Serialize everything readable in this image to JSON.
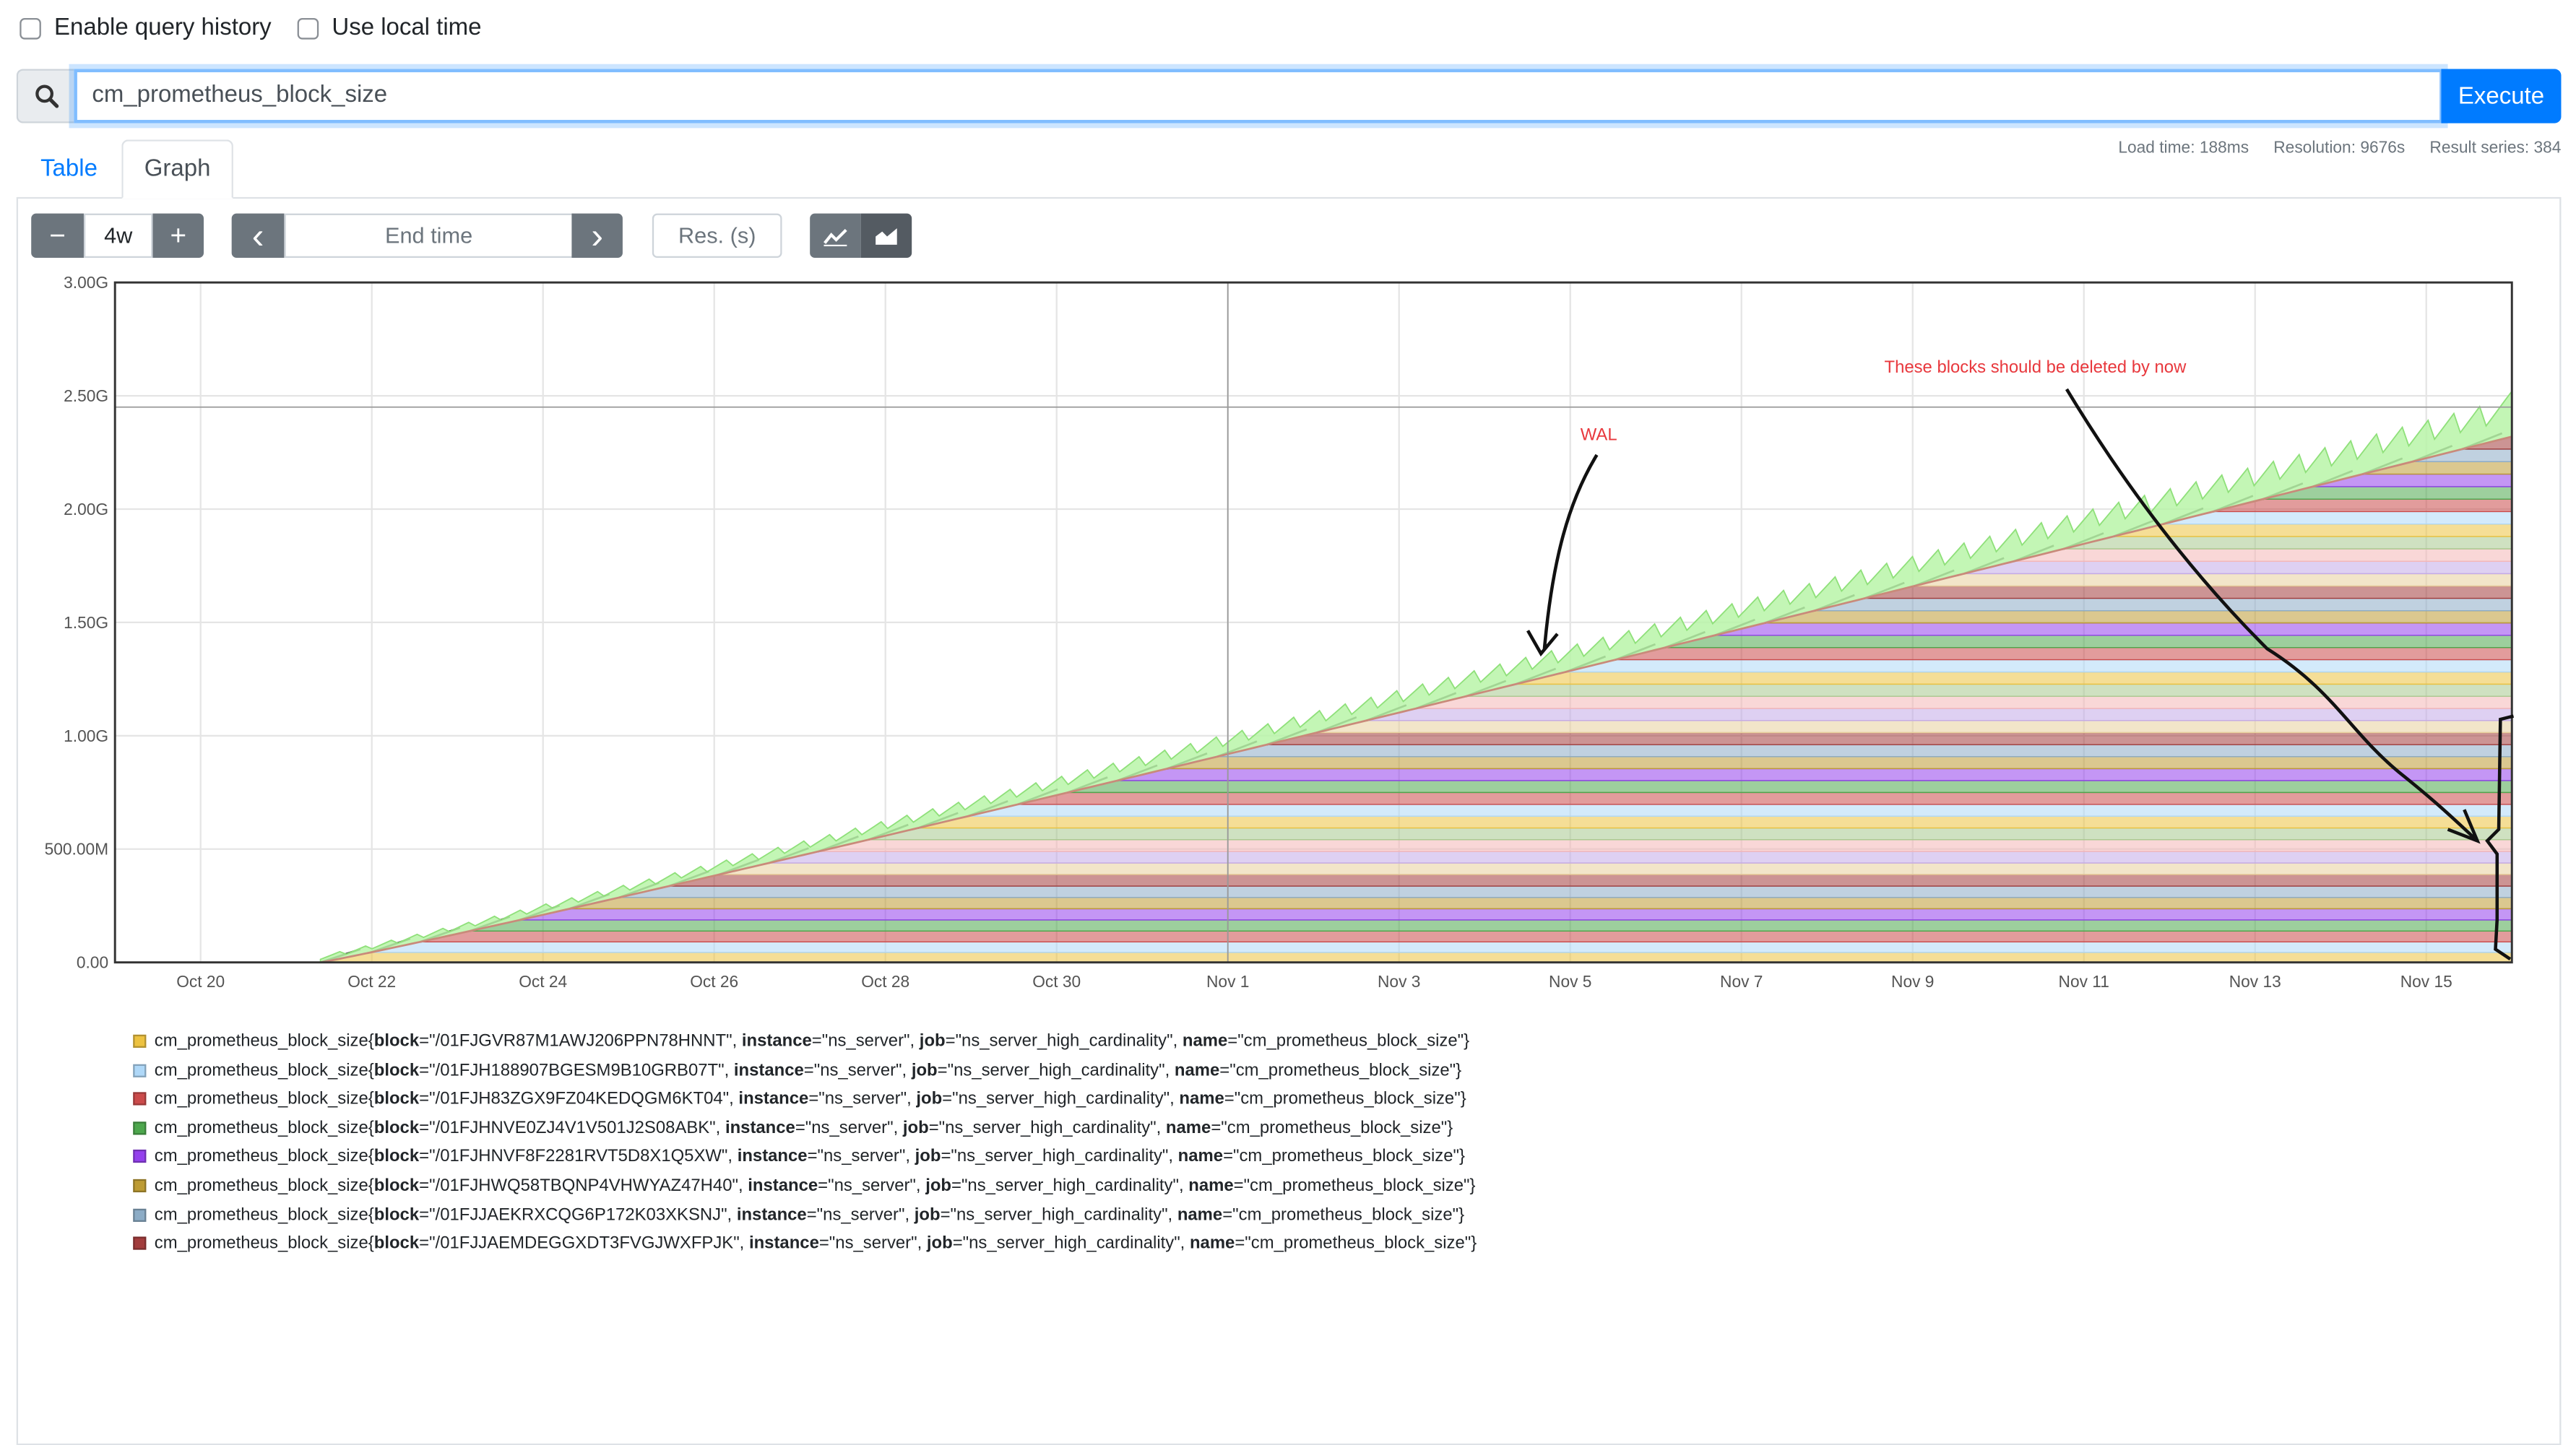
{
  "options": {
    "query_history_label": "Enable query history",
    "local_time_label": "Use local time"
  },
  "search": {
    "query": "cm_prometheus_block_size",
    "execute_label": "Execute"
  },
  "tabs": {
    "table": "Table",
    "graph": "Graph"
  },
  "stats": {
    "load_time": "Load time: 188ms",
    "resolution": "Resolution: 9676s",
    "result_series": "Result series: 384"
  },
  "controls": {
    "range_minus": "−",
    "range_value": "4w",
    "range_plus": "+",
    "prev": "‹",
    "end_time_placeholder": "End time",
    "next": "›",
    "res_placeholder": "Res. (s)",
    "line_icon": "line-chart-icon",
    "stacked_icon": "stacked-area-chart-icon"
  },
  "colors": {
    "accent": "#007bff",
    "annotation": "#e8383d",
    "wal_fill": "#b8f5a8",
    "series_palette": [
      "#edc240",
      "#afd8f8",
      "#cb4b4b",
      "#4da74d",
      "#9440ed",
      "#bd9b33",
      "#8cacc6",
      "#a23c3c",
      "#e8d09c",
      "#c3a9e8",
      "#f4b7b7",
      "#a8c98e"
    ]
  },
  "chart_data": {
    "type": "area",
    "stacked": true,
    "y_ticks": [
      "0.00",
      "500.00M",
      "1.00G",
      "1.50G",
      "2.00G",
      "2.50G",
      "3.00G"
    ],
    "ylim": [
      0,
      3.0
    ],
    "x_ticks": [
      "Oct 20",
      "Oct 22",
      "Oct 24",
      "Oct 26",
      "Oct 28",
      "Oct 30",
      "Nov 1",
      "Nov 3",
      "Nov 5",
      "Nov 7",
      "Nov 9",
      "Nov 11",
      "Nov 13",
      "Nov 15"
    ],
    "xlim_days": [
      "Oct 19",
      "Nov 16"
    ],
    "wal_peak_y": 2.52,
    "block_stack_top_y": 2.32,
    "annotations": [
      {
        "text": "WAL"
      },
      {
        "text": "These blocks should be deleted by now"
      }
    ]
  },
  "legend": {
    "metric": "cm_prometheus_block_size",
    "series": [
      {
        "block": "/01FJGVR87M1AWJ206PPN78HNNT",
        "instance": "ns_server",
        "job": "ns_server_high_cardinality",
        "name": "cm_prometheus_block_size",
        "color": "#edc240"
      },
      {
        "block": "/01FJH188907BGESM9B10GRB07T",
        "instance": "ns_server",
        "job": "ns_server_high_cardinality",
        "name": "cm_prometheus_block_size",
        "color": "#afd8f8"
      },
      {
        "block": "/01FJH83ZGX9FZ04KEDQGM6KT04",
        "instance": "ns_server",
        "job": "ns_server_high_cardinality",
        "name": "cm_prometheus_block_size",
        "color": "#cb4b4b"
      },
      {
        "block": "/01FJHNVE0ZJ4V1V501J2S08ABK",
        "instance": "ns_server",
        "job": "ns_server_high_cardinality",
        "name": "cm_prometheus_block_size",
        "color": "#4da74d"
      },
      {
        "block": "/01FJHNVF8F2281RVT5D8X1Q5XW",
        "instance": "ns_server",
        "job": "ns_server_high_cardinality",
        "name": "cm_prometheus_block_size",
        "color": "#9440ed"
      },
      {
        "block": "/01FJHWQ58TBQNP4VHWYAZ47H40",
        "instance": "ns_server",
        "job": "ns_server_high_cardinality",
        "name": "cm_prometheus_block_size",
        "color": "#bd9b33"
      },
      {
        "block": "/01FJJAEKRXCQG6P172K03XKSNJ",
        "instance": "ns_server",
        "job": "ns_server_high_cardinality",
        "name": "cm_prometheus_block_size",
        "color": "#8cacc6"
      },
      {
        "block": "/01FJJAEMDEGGXDT3FVGJWXFPJK",
        "instance": "ns_server",
        "job": "ns_server_high_cardinality",
        "name": "cm_prometheus_block_size",
        "color": "#a23c3c"
      }
    ]
  }
}
